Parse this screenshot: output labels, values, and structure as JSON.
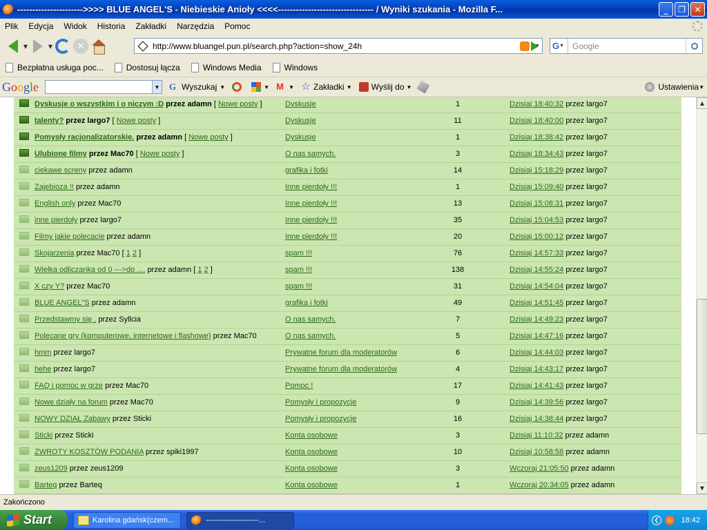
{
  "window": {
    "title": "---------------------->>>> BLUE ANGEL'S - Niebieskie Anioły <<<<-------------------------------- / Wyniki szukania - Mozilla F...",
    "min_label": "_",
    "max_label": "❐",
    "close_label": "✕"
  },
  "menu": {
    "items": [
      "Plik",
      "Edycja",
      "Widok",
      "Historia",
      "Zakładki",
      "Narzędzia",
      "Pomoc"
    ]
  },
  "nav": {
    "url": "http://www.bluangel.pun.pl/search.php?action=show_24h",
    "search_placeholder": "Google"
  },
  "bookmarks": [
    "Bezpłatna usługa poc...",
    "Dostosuj łącza",
    "Windows Media",
    "Windows"
  ],
  "google_toolbar": {
    "search_label": "Wyszukaj",
    "bookmarks_label": "Zakładki",
    "send_label": "Wyślij do",
    "settings_label": "Ustawienia"
  },
  "results": {
    "rows": [
      {
        "new": true,
        "topic": "Dyskusje o wszystkim i o niczym :D",
        "author": "przez adamn",
        "extra": "[ ",
        "newposts": "Nowe posty",
        "extra_end": " ]",
        "forum": "Dyskusje",
        "count": "1",
        "date": "Dzisiaj 18:40:32",
        "by": "przez largo7"
      },
      {
        "new": true,
        "topic": "talenty?",
        "author": "przez largo7",
        "extra": "[ ",
        "newposts": "Nowe posty",
        "extra_end": " ]",
        "forum": "Dyskusje",
        "count": "11",
        "date": "Dzisiaj 18:40:00",
        "by": "przez largo7"
      },
      {
        "new": true,
        "topic": "Pomysły racjonalizatorskie.",
        "author": "przez adamn",
        "extra": "[ ",
        "newposts": "Nowe posty",
        "extra_end": " ]",
        "forum": "Dyskusje",
        "count": "1",
        "date": "Dzisiaj 18:38:42",
        "by": "przez largo7"
      },
      {
        "new": true,
        "topic": "Ulubione filmy",
        "author": "przez Mac70",
        "extra": "[ ",
        "newposts": "Nowe posty",
        "extra_end": " ]",
        "forum": "O nas samych.",
        "count": "3",
        "date": "Dzisiaj 18:34:43",
        "by": "przez largo7"
      },
      {
        "new": false,
        "topic": "ciekawe screny",
        "author": "przez adamn",
        "forum": "grafika i fotki",
        "count": "14",
        "date": "Dzisiaj 15:18:29",
        "by": "przez largo7"
      },
      {
        "new": false,
        "topic": "Zajebioza !!",
        "author": "przez adamn",
        "forum": "Inne pierdoły !!!",
        "count": "1",
        "date": "Dzisiaj 15:09:40",
        "by": "przez largo7"
      },
      {
        "new": false,
        "topic": "English only",
        "author": "przez Mac70",
        "forum": "Inne pierdoły !!!",
        "count": "13",
        "date": "Dzisiaj 15:08:31",
        "by": "przez largo7"
      },
      {
        "new": false,
        "topic": "inne pierdoły",
        "author": "przez largo7",
        "forum": "Inne pierdoły !!!",
        "count": "35",
        "date": "Dzisiaj 15:04:53",
        "by": "przez largo7"
      },
      {
        "new": false,
        "topic": "Filmy jakie polecacie",
        "author": "przez adamn",
        "forum": "Inne pierdoły !!!",
        "count": "20",
        "date": "Dzisiaj 15:00:12",
        "by": "przez largo7"
      },
      {
        "new": false,
        "topic": "Skojarzenia",
        "author": "przez Mac70",
        "pages": [
          "1",
          "2"
        ],
        "forum": "spam !!!",
        "count": "76",
        "date": "Dzisiaj 14:57:33",
        "by": "przez largo7"
      },
      {
        "new": false,
        "topic": "Wielka odliczanka od 0 --->do ....",
        "author": "przez adamn",
        "pages": [
          "1",
          "2"
        ],
        "forum": "spam !!!",
        "count": "138",
        "date": "Dzisiaj 14:55:24",
        "by": "przez largo7"
      },
      {
        "new": false,
        "topic": "X czy Y?",
        "author": "przez Mac70",
        "forum": "spam !!!",
        "count": "31",
        "date": "Dzisiaj 14:54:04",
        "by": "przez largo7"
      },
      {
        "new": false,
        "topic": "BLUE ANGEL\"S",
        "author": "przez adamn",
        "forum": "grafika i fotki",
        "count": "49",
        "date": "Dzisiaj 14:51:45",
        "by": "przez largo7"
      },
      {
        "new": false,
        "topic": "Przedstawmy się .",
        "author": "przez Syllcia",
        "forum": "O nas samych.",
        "count": "7",
        "date": "Dzisiaj 14:49:23",
        "by": "przez largo7"
      },
      {
        "new": false,
        "topic": "Polecane gry (komputerowe, internetowe i flashowe)",
        "author": "przez Mac70",
        "forum": "O nas samych.",
        "count": "5",
        "date": "Dzisiaj 14:47:16",
        "by": "przez largo7"
      },
      {
        "new": false,
        "topic": "hmm",
        "author": "przez largo7",
        "forum": "Prywatne forum dla moderatorów",
        "count": "6",
        "date": "Dzisiaj 14:44:03",
        "by": "przez largo7"
      },
      {
        "new": false,
        "topic": "hehe",
        "author": "przez largo7",
        "forum": "Prywatne forum dla moderatorów",
        "count": "4",
        "date": "Dzisiaj 14:43:17",
        "by": "przez largo7"
      },
      {
        "new": false,
        "topic": "FAQ i pomoc w grze",
        "author": "przez Mac70",
        "forum": "Pomoc !",
        "count": "17",
        "date": "Dzisiaj 14:41:43",
        "by": "przez largo7"
      },
      {
        "new": false,
        "topic": "Nowe działy na forum",
        "author": "przez Mac70",
        "forum": "Pomysły i propozycje",
        "count": "9",
        "date": "Dzisiaj 14:39:56",
        "by": "przez largo7"
      },
      {
        "new": false,
        "topic": "NOWY DZIAŁ Zabawy",
        "author": "przez Sticki",
        "forum": "Pomysły i propozycje",
        "count": "16",
        "date": "Dzisiaj 14:38:44",
        "by": "przez largo7"
      },
      {
        "new": false,
        "topic": "Sticki",
        "author": "przez Sticki",
        "forum": "Konta osobowe",
        "count": "3",
        "date": "Dzisiaj 11:10:32",
        "by": "przez adamn"
      },
      {
        "new": false,
        "topic": "ZWROTY KOSZTÓW PODANIA",
        "author": "przez spiki1997",
        "forum": "Konta osobowe",
        "count": "10",
        "date": "Dzisiaj 10:58:58",
        "by": "przez adamn"
      },
      {
        "new": false,
        "topic": "zeus1209",
        "author": "przez zeus1209",
        "forum": "Konta osobowe",
        "count": "3",
        "date": "Wczoraj 21:05:50",
        "by": "przez adamn"
      },
      {
        "new": false,
        "topic": "Barteq",
        "author": "przez Barteq",
        "forum": "Konta osobowe",
        "count": "1",
        "date": "Wczoraj 20:34:05",
        "by": "przez adamn"
      }
    ]
  },
  "status": {
    "text": "Zakończono"
  },
  "taskbar": {
    "start_label": "Start",
    "task1": "Karolina gdańsk(czem...",
    "task2": "---------------------...",
    "clock": "18:42"
  }
}
